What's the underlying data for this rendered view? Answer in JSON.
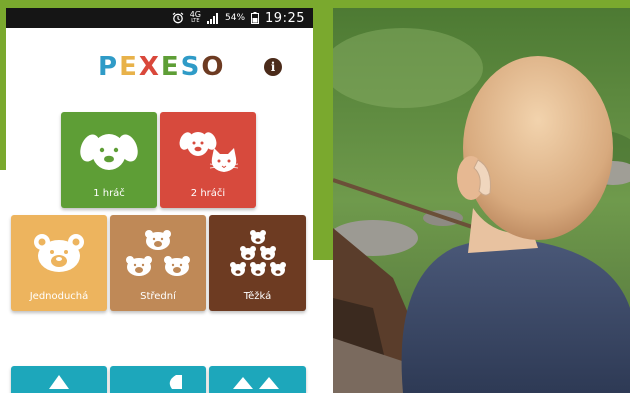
{
  "status_bar": {
    "network": "4G",
    "network_sub": "LTE",
    "battery": "54%",
    "time": "19:25",
    "icons": [
      "alarm-icon",
      "signal-icon",
      "battery-icon"
    ]
  },
  "app": {
    "title_letters": [
      {
        "char": "P",
        "color": "#2f9bc7"
      },
      {
        "char": "E",
        "color": "#e8b24a"
      },
      {
        "char": "X",
        "color": "#d9483b"
      },
      {
        "char": "E",
        "color": "#5e9e36"
      },
      {
        "char": "S",
        "color": "#2f9bc7"
      },
      {
        "char": "O",
        "color": "#6d3b22"
      }
    ],
    "info_icon": "i"
  },
  "players": {
    "one": {
      "label": "1 hráč",
      "icon": "dog-face-icon",
      "color": "#5e9e36"
    },
    "two": {
      "label": "2 hráči",
      "icon": "dog-and-cat-icon",
      "color": "#d74a3d"
    }
  },
  "difficulty": {
    "easy": {
      "label": "Jednoduchá",
      "icon": "bear-single-icon",
      "color": "#edb45e"
    },
    "medium": {
      "label": "Střední",
      "icon": "bears-three-icon",
      "color": "#bf8957"
    },
    "hard": {
      "label": "Těžká",
      "icon": "bears-six-icon",
      "color": "#6d3b22"
    }
  },
  "bottom_tiles": {
    "color": "#1da7bb",
    "icons": [
      "triangle-icon",
      "moon-icon",
      "mountains-icon"
    ]
  },
  "photo": {
    "subject": "child-with-hearing-aid-photo"
  }
}
